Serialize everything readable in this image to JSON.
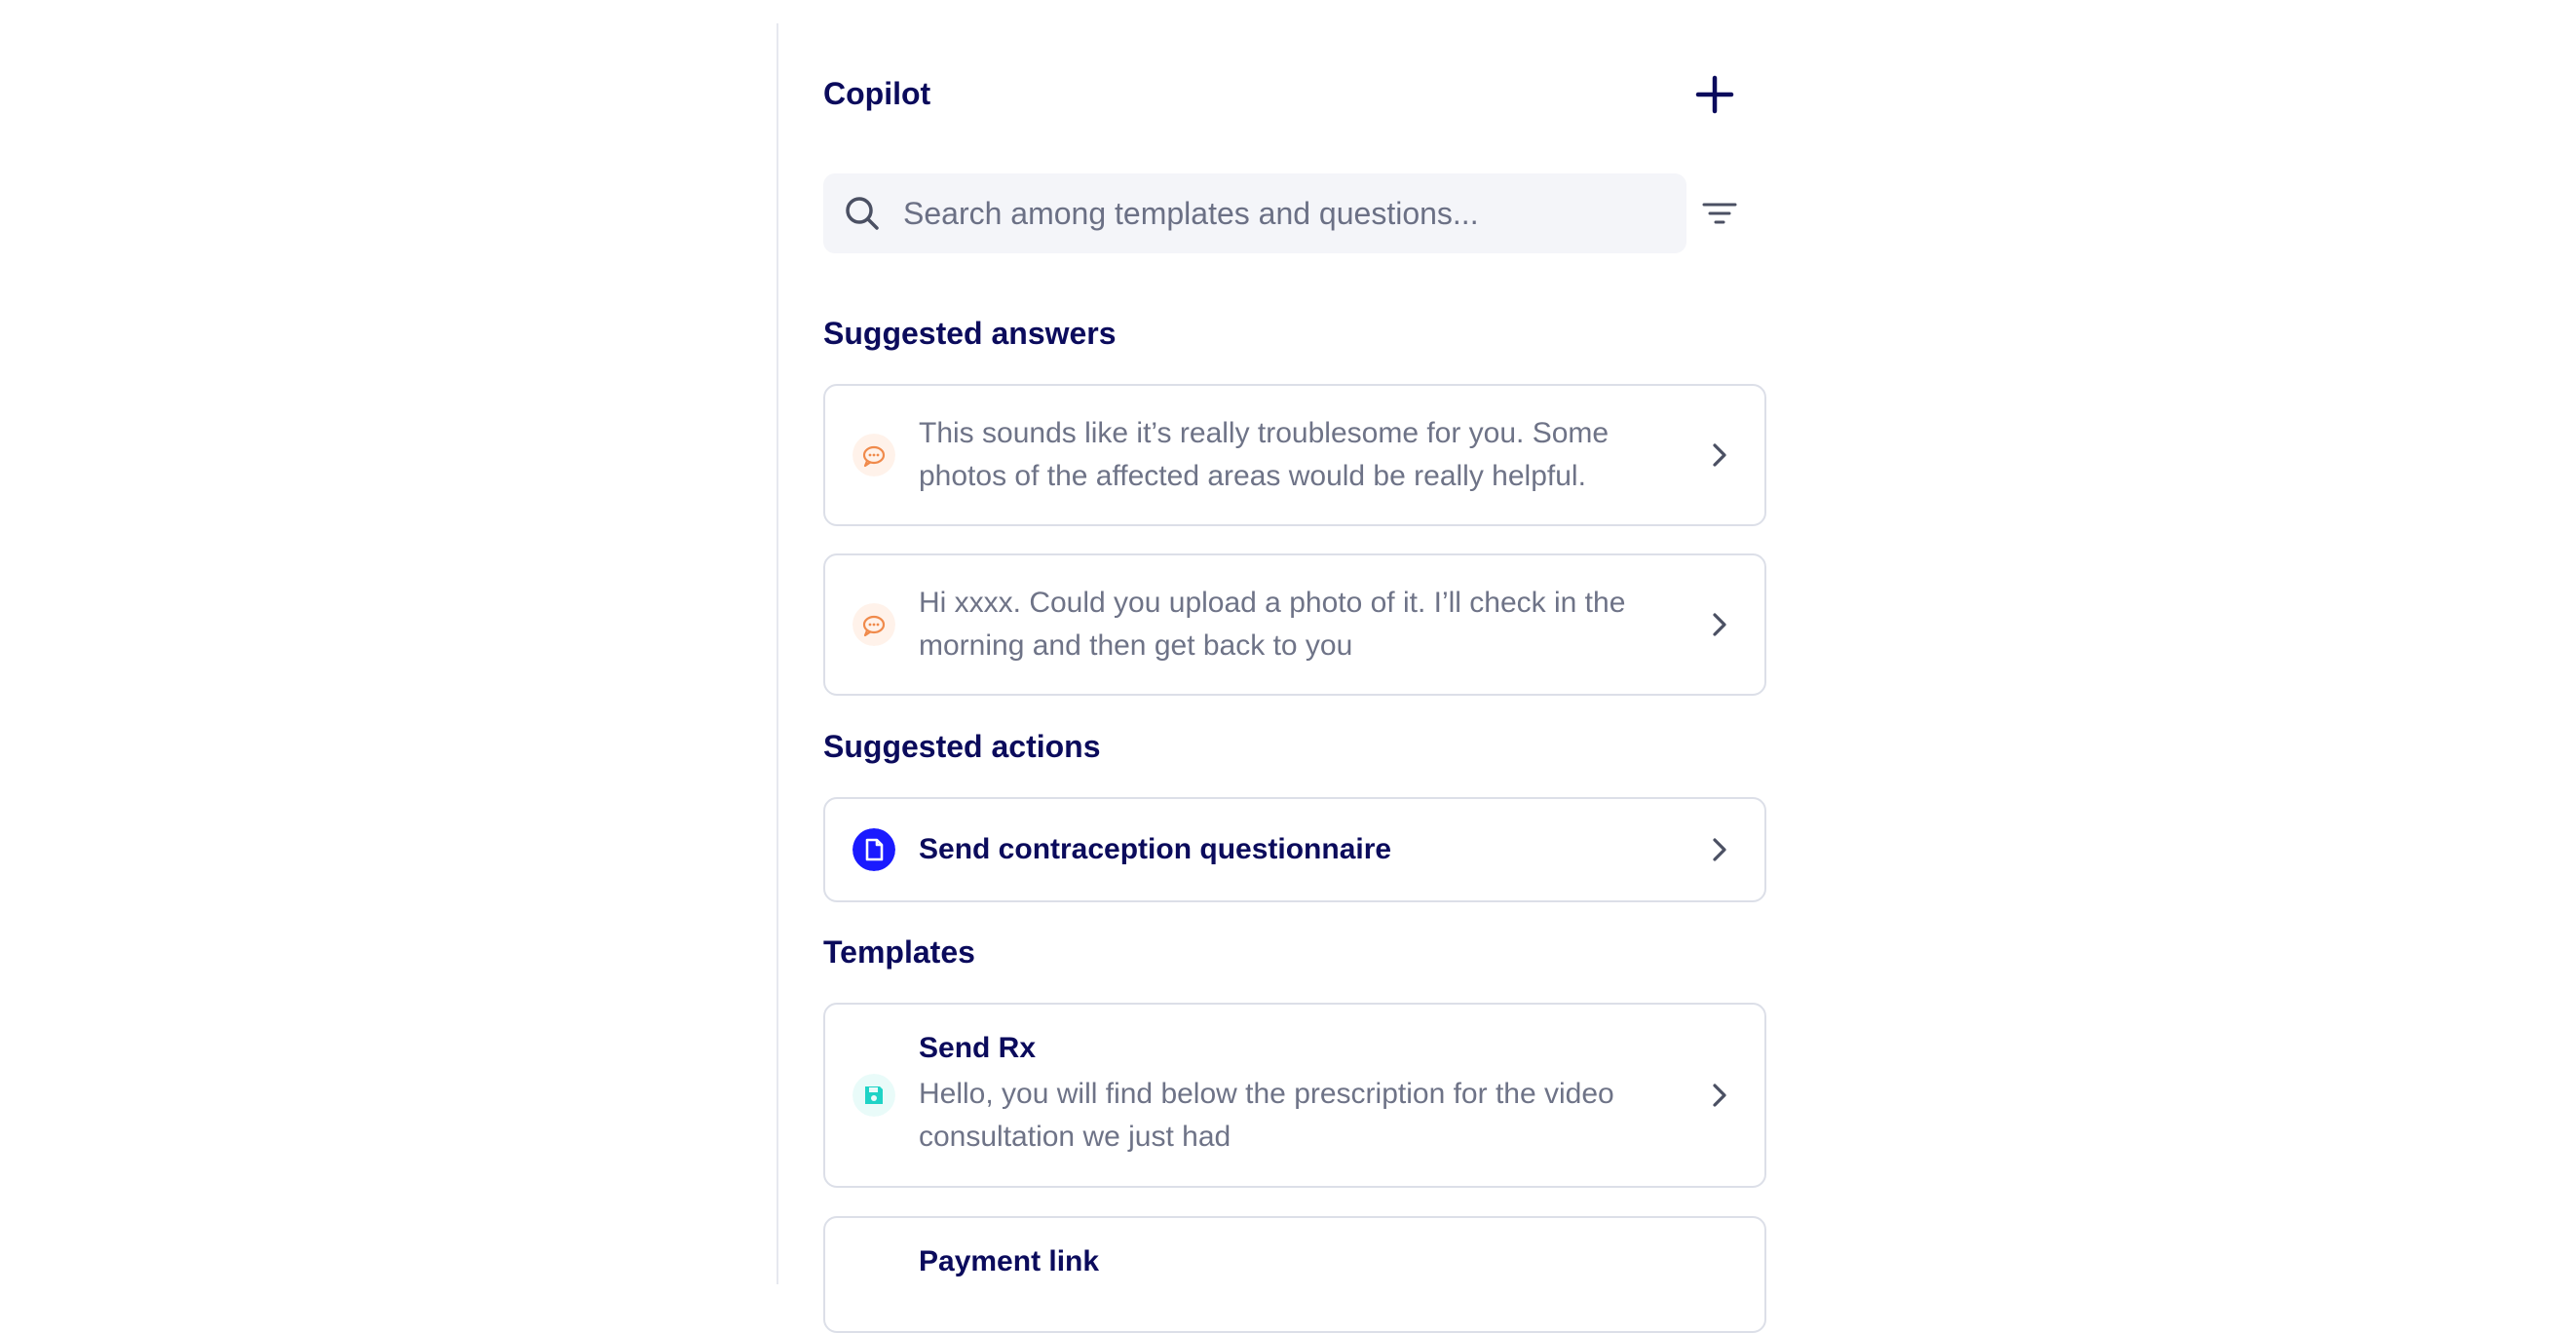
{
  "header": {
    "title": "Copilot",
    "add_icon": "plus-icon"
  },
  "search": {
    "placeholder": "Search among templates and questions...",
    "value": "",
    "icon": "search-icon",
    "filter_icon": "filter-icon"
  },
  "suggested_answers": {
    "title": "Suggested answers",
    "items": [
      {
        "text": "This sounds like it’s really troublesome for you. Some photos of the affected areas would be really helpful.",
        "icon": "chat-bubble-icon"
      },
      {
        "text": "Hi xxxx. Could you upload a photo of it. I’ll check in the morning and then get back to you",
        "icon": "chat-bubble-icon"
      }
    ]
  },
  "suggested_actions": {
    "title": "Suggested actions",
    "items": [
      {
        "label": "Send contraception questionnaire",
        "icon": "document-icon"
      }
    ]
  },
  "templates": {
    "title": "Templates",
    "items": [
      {
        "title": "Send Rx",
        "body": "Hello, you will find below the prescription for the video consultation we just had",
        "icon": "save-icon"
      },
      {
        "title": "Payment link",
        "body": "",
        "icon": ""
      }
    ]
  },
  "colors": {
    "text_primary": "#0b0b5c",
    "text_secondary": "#6e7387",
    "answer_icon": "#f08a4b",
    "action_icon_bg": "#1a1aff",
    "template_icon": "#1fd3c6",
    "card_border": "#dcdfe8",
    "search_bg": "#f4f5f9"
  }
}
